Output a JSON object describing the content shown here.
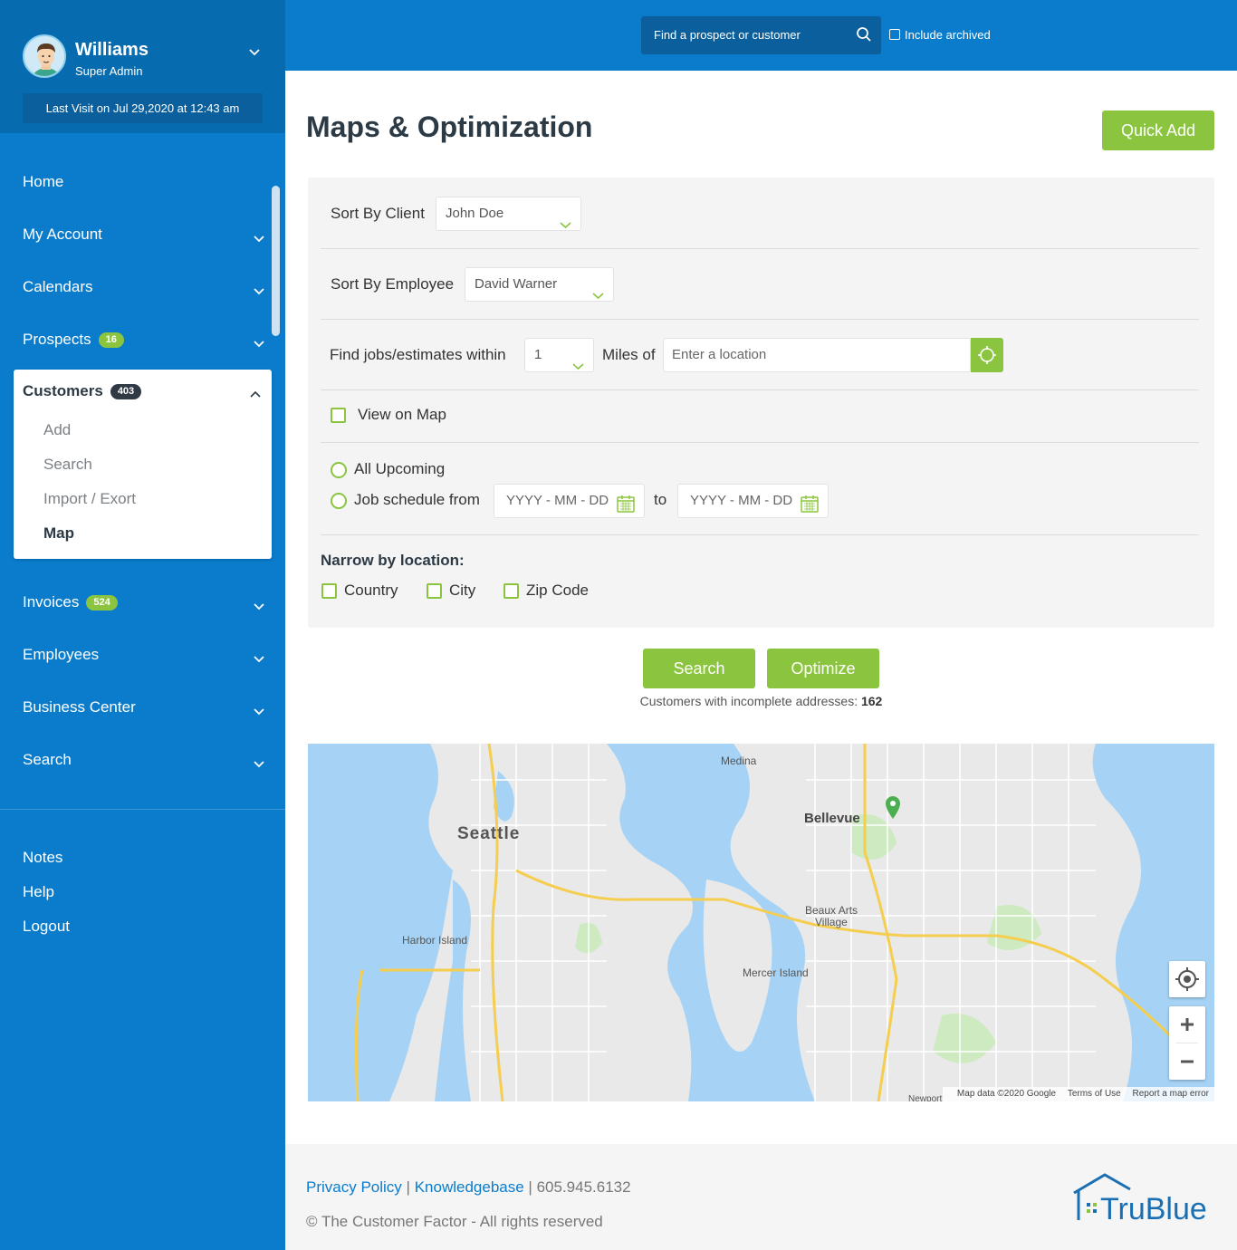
{
  "user": {
    "name": "Williams",
    "role": "Super Admin",
    "last_visit": "Last Visit on Jul 29,2020 at 12:43 am"
  },
  "topbar": {
    "search_placeholder": "Find a prospect or customer",
    "include_archived": "Include archived"
  },
  "nav": {
    "home": "Home",
    "my_account": "My Account",
    "calendars": "Calendars",
    "prospects": "Prospects",
    "prospects_count": "16",
    "customers": "Customers",
    "customers_count": "403",
    "customers_sub": [
      "Add",
      "Search",
      "Import / Exort",
      "Map"
    ],
    "invoices": "Invoices",
    "invoices_count": "524",
    "employees": "Employees",
    "business_center": "Business Center",
    "search": "Search",
    "notes": "Notes",
    "help": "Help",
    "logout": "Logout"
  },
  "page": {
    "title": "Maps & Optimization",
    "quick_add": "Quick Add"
  },
  "filters": {
    "sort_client_label": "Sort By Client",
    "sort_client_value": "John Doe",
    "sort_employee_label": "Sort By Employee",
    "sort_employee_value": "David Warner",
    "find_within_label": "Find jobs/estimates within",
    "find_within_value": "1",
    "miles_of_label": "Miles of",
    "location_placeholder": "Enter a location",
    "view_on_map": "View on Map",
    "all_upcoming": "All Upcoming",
    "job_schedule_from": "Job schedule from",
    "date_placeholder": "YYYY - MM - DD",
    "to_label": "to",
    "narrow_label": "Narrow by location:",
    "country": "Country",
    "city": "City",
    "zip": "Zip Code"
  },
  "actions": {
    "search": "Search",
    "optimize": "Optimize",
    "incomplete_label": "Customers with incomplete addresses:",
    "incomplete_count": "162"
  },
  "map": {
    "labels": {
      "medina": "Medina",
      "seattle": "Seattle",
      "bellevue": "Bellevue",
      "beaux_arts": "Beaux Arts",
      "village": "Village",
      "harbor_island": "Harbor Island",
      "mercer_island": "Mercer Island",
      "newport": "Newport"
    },
    "footer": {
      "data": "Map data ©2020 Google",
      "terms": "Terms of Use",
      "report": "Report a map error"
    }
  },
  "footer": {
    "privacy": "Privacy Policy",
    "sep": "|",
    "knowledgebase": "Knowledgebase",
    "phone": "605.945.6132",
    "copyright": "© The Customer Factor - All rights reserved",
    "brand": "TruBlue"
  },
  "colors": {
    "primary_blue": "#0a7ccb",
    "dark_blue": "#076bb0",
    "accent_green": "#8bc53f",
    "water": "#a6d3f5"
  }
}
